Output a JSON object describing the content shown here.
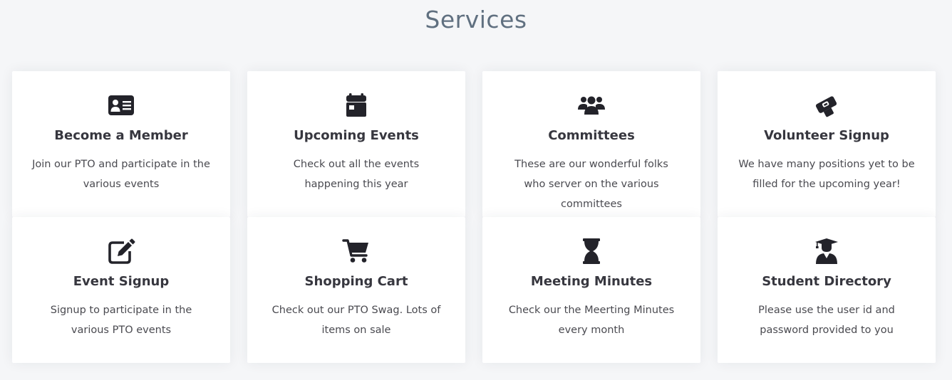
{
  "section": {
    "title": "Services"
  },
  "colors": {
    "background": "#f5f6f8",
    "card": "#ffffff",
    "title": "#607080",
    "icon": "#23232a"
  },
  "cards": [
    {
      "icon": "id-card-icon",
      "title": "Become a Member",
      "desc": "Join our PTO and participate in the various events"
    },
    {
      "icon": "calendar-icon",
      "title": "Upcoming Events",
      "desc": "Check out all the events happening this year"
    },
    {
      "icon": "users-icon",
      "title": "Committees",
      "desc": "These are our wonderful folks who server on the various committees"
    },
    {
      "icon": "handshake-icon",
      "title": "Volunteer Signup",
      "desc": "We have many positions yet to be filled for the upcoming year!"
    },
    {
      "icon": "edit-icon",
      "title": "Event Signup",
      "desc": "Signup to participate in the various PTO events"
    },
    {
      "icon": "shopping-cart-icon",
      "title": "Shopping Cart",
      "desc": "Check out our PTO Swag. Lots of items on sale"
    },
    {
      "icon": "hourglass-icon",
      "title": "Meeting Minutes",
      "desc": "Check our the Meerting Minutes every month"
    },
    {
      "icon": "graduate-icon",
      "title": "Student Directory",
      "desc": "Please use the user id and password provided to you"
    }
  ]
}
